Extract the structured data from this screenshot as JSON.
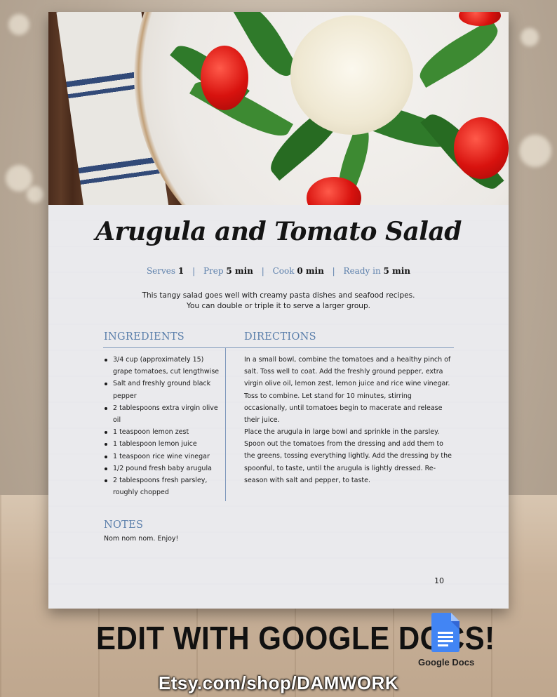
{
  "recipe": {
    "title": "Arugula and Tomato Salad",
    "meta": {
      "serves_label": "Serves",
      "serves_value": "1",
      "prep_label": "Prep",
      "prep_value": "5 min",
      "cook_label": "Cook",
      "cook_value": "0 min",
      "ready_label": "Ready in",
      "ready_value": "5 min",
      "separator": "|"
    },
    "intro": [
      "This tangy salad goes well with creamy pasta dishes and seafood recipes.",
      "You can double or triple it to serve a larger group."
    ],
    "ingredients_heading": "INGREDIENTS",
    "ingredients": [
      "3/4 cup (approximately 15) grape tomatoes, cut lengthwise",
      "Salt and freshly ground black pepper",
      "2 tablespoons extra virgin olive oil",
      "1 teaspoon lemon zest",
      "1 tablespoon lemon juice",
      "1 teaspoon rice wine vinegar",
      "1/2 pound fresh baby arugula",
      "2 tablespoons fresh parsley, roughly chopped"
    ],
    "directions_heading": "DIRECTIONS",
    "directions": [
      "In a small bowl, combine the tomatoes and a healthy pinch of salt. Toss well to coat. Add the freshly ground pepper, extra virgin olive oil, lemon zest, lemon juice and rice wine vinegar. Toss to combine. Let stand for 10 minutes, stirring occasionally, until tomatoes begin to macerate and release their juice.",
      "Place the arugula in large bowl and sprinkle in the parsley. Spoon out the tomatoes from the dressing and add them to the greens, tossing everything lightly. Add the dressing by the spoonful, to taste, until the arugula is lightly dressed. Re-season with salt and pepper, to taste."
    ],
    "notes_heading": "NOTES",
    "notes": "Nom nom nom. Enjoy!",
    "page_number": "10"
  },
  "banner": {
    "edit_text": "EDIT WITH GOOGLE DOCS!",
    "shop_url": "Etsy.com/shop/DAMWORK",
    "google_docs_label": "Google Docs",
    "google_docs_icon": "google-docs-icon"
  },
  "colors": {
    "accent_blue": "#5b7fab",
    "rule_blue": "#7f98bb",
    "text": "#1a1a1a"
  }
}
